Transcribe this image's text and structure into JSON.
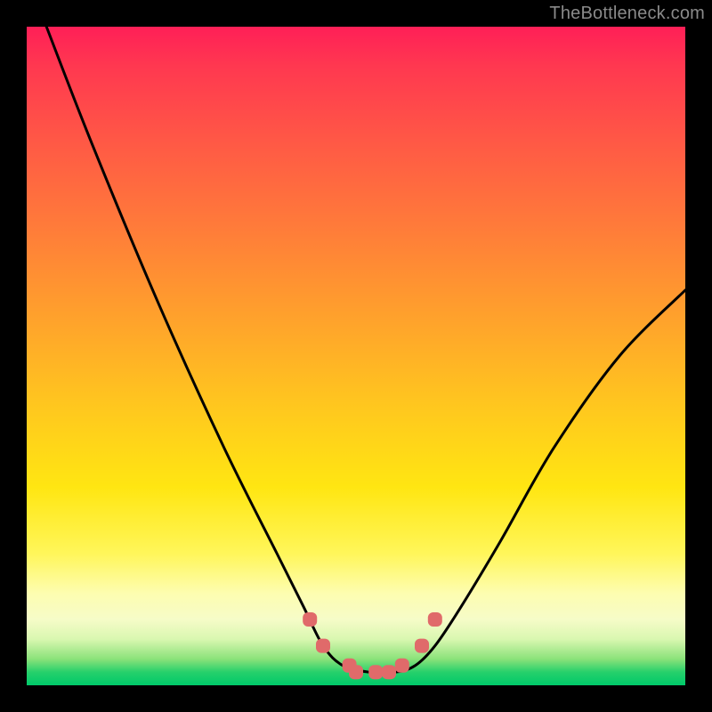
{
  "watermark": "TheBottleneck.com",
  "chart_data": {
    "type": "line",
    "title": "",
    "xlabel": "",
    "ylabel": "",
    "xlim": [
      0,
      100
    ],
    "ylim": [
      0,
      100
    ],
    "series": [
      {
        "name": "curve",
        "x": [
          3,
          10,
          20,
          30,
          38,
          42,
          45,
          48,
          52,
          56,
          59,
          62,
          66,
          72,
          80,
          90,
          100
        ],
        "values": [
          100,
          82,
          58,
          36,
          20,
          12,
          6,
          3,
          2,
          2,
          3,
          6,
          12,
          22,
          36,
          50,
          60
        ]
      }
    ],
    "markers": {
      "name": "highlight-dots",
      "color": "#e06a6a",
      "x": [
        43,
        45,
        49,
        50,
        53,
        55,
        57,
        60,
        62
      ],
      "values": [
        10,
        6,
        3,
        2,
        2,
        2,
        3,
        6,
        10
      ]
    },
    "gradient_stops": [
      {
        "pos": 0,
        "color": "#ff1f57"
      },
      {
        "pos": 30,
        "color": "#ff7a3a"
      },
      {
        "pos": 60,
        "color": "#ffd21a"
      },
      {
        "pos": 85,
        "color": "#fdfdb0"
      },
      {
        "pos": 100,
        "color": "#00c96a"
      }
    ]
  }
}
